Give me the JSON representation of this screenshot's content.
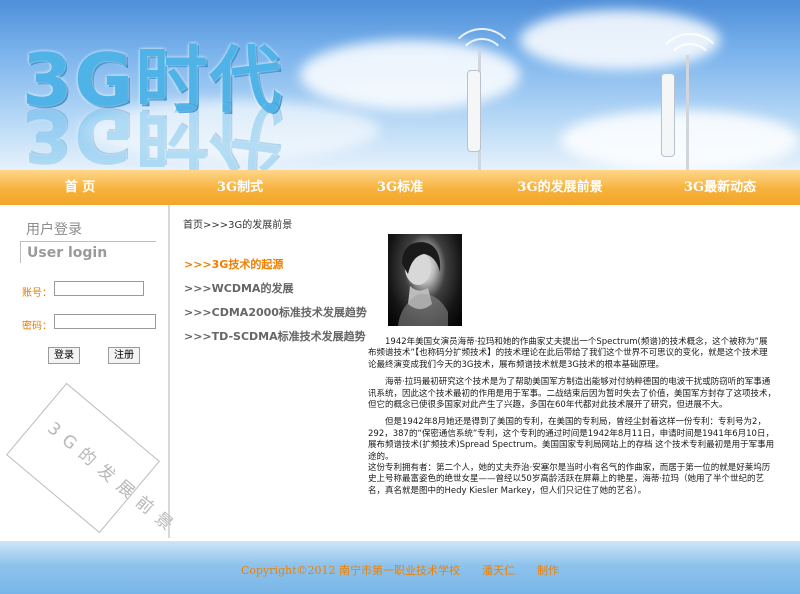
{
  "banner": {
    "logo_text": "3G时代"
  },
  "nav": {
    "items": [
      {
        "label": "首 页"
      },
      {
        "label": "3G制式"
      },
      {
        "label": "3G标准"
      },
      {
        "label": "3G的发展前景"
      },
      {
        "label": "3G最新动态"
      }
    ]
  },
  "login": {
    "title": "用户登录",
    "subtitle": "User login",
    "account_label": "账号：",
    "password_label": "密码：",
    "account_value": "",
    "password_value": "",
    "login_button": "登录",
    "register_button": "注册",
    "stamp_text": "3G的发展前景"
  },
  "breadcrumb": "首页>>>3G的发展前景",
  "menu": {
    "items": [
      {
        "label": ">>>3G技术的起源"
      },
      {
        "label": ">>>WCDMA的发展"
      },
      {
        "label": ">>>CDMA2000标准技术发展趋势"
      },
      {
        "label": ">>>TD-SCDMA标准技术发展趋势"
      }
    ]
  },
  "article": {
    "p1": "　　1942年美国女演员海蒂·拉玛和她的作曲家丈夫提出一个Spectrum(频谱)的技术概念，这个被称为“展布频谱技术”【也称码分扩频技术】的技术理论在此后带给了我们这个世界不可思议的变化，就是这个技术理论最终演变成我们今天的3G技术，展布频谱技术就是3G技术的根本基础原理。",
    "p2": "　　海蒂·拉玛最初研究这个技术是为了帮助美国军方制造出能够对付纳粹德国的电波干扰或防窃听的军事通讯系统，因此这个技术最初的作用是用于军事。二战结束后因为暂时失去了价值，美国军方封存了这项技术，但它的概念已使很多国家对此产生了兴趣，多国在60年代都对此技术展开了研究，但进展不大。",
    "p3": "　　但是1942年8月她还是得到了美国的专利，在美国的专利局，曾经尘封着这样一份专利：专利号为2，292，387的“保密通信系统”专利，这个专利的通过时间是1942年8月11日，申请时间是1941年6月10日，",
    "p4": "展布频谱技术(扩频技术)Spread Spectrum。美国国家专利局网站上的存档 这个技术专利最初是用于军事用途的。",
    "p5": "这份专利拥有者：第二个人，她的丈夫乔治·安塞尔是当时小有名气的作曲家，而居于第一位的就是好莱坞历史上号称最富姿色的绝世女星——曾经以50岁高龄活跃在屏幕上的艳星，海蒂·拉玛（她用了半个世纪的艺名，真名就是图中的Hedy Kiesler Markey，但人们只记住了她的艺名）。"
  },
  "footer": {
    "copyright": "Copyright©2012 南宁市第一职业技术学校　　潘天仁　　制作"
  },
  "colors": {
    "accent_orange": "#f07f00",
    "nav_orange": "#f6b23c",
    "sky_blue": "#79b2ec"
  }
}
